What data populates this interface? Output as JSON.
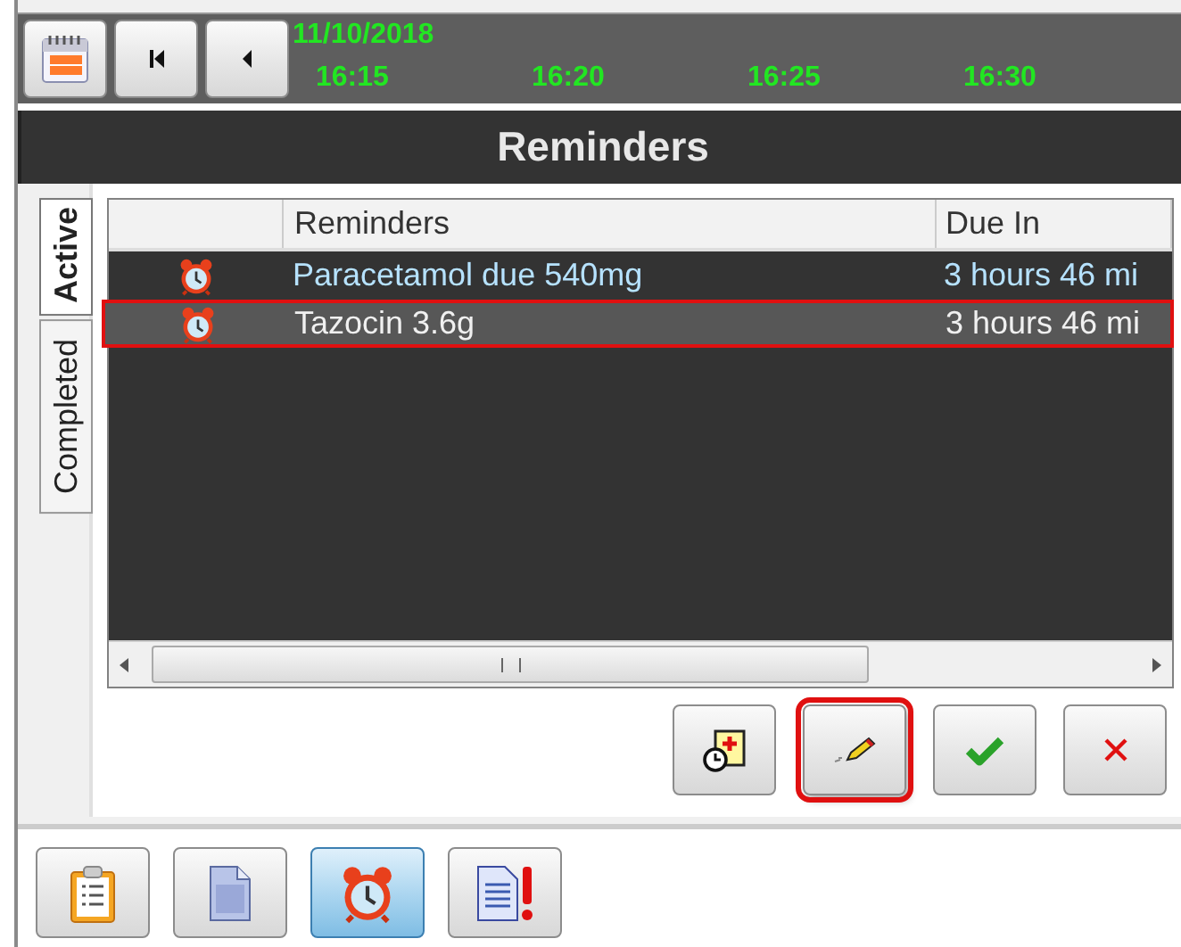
{
  "timeline": {
    "date": "11/10/2018",
    "times": [
      "16:15",
      "16:20",
      "16:25",
      "16:30"
    ]
  },
  "panel": {
    "title": "Reminders"
  },
  "tabs": [
    {
      "label": "Active",
      "selected": true
    },
    {
      "label": "Completed",
      "selected": false
    }
  ],
  "table": {
    "columns": [
      "Reminders",
      "Due In"
    ],
    "rows": [
      {
        "reminder": "Paracetamol due 540mg",
        "due_in": "3 hours 46 mi",
        "selected": false
      },
      {
        "reminder": "Tazocin 3.6g",
        "due_in": "3 hours 46 mi",
        "selected": true
      }
    ]
  },
  "actions": [
    {
      "kind": "add",
      "highlighted": false
    },
    {
      "kind": "edit",
      "highlighted": true
    },
    {
      "kind": "confirm",
      "highlighted": false
    },
    {
      "kind": "cancel",
      "highlighted": false
    }
  ],
  "bottom_toolbar": [
    {
      "kind": "clipboard",
      "selected": false
    },
    {
      "kind": "document",
      "selected": false
    },
    {
      "kind": "alarm",
      "selected": true
    },
    {
      "kind": "alert-document",
      "selected": false
    }
  ]
}
